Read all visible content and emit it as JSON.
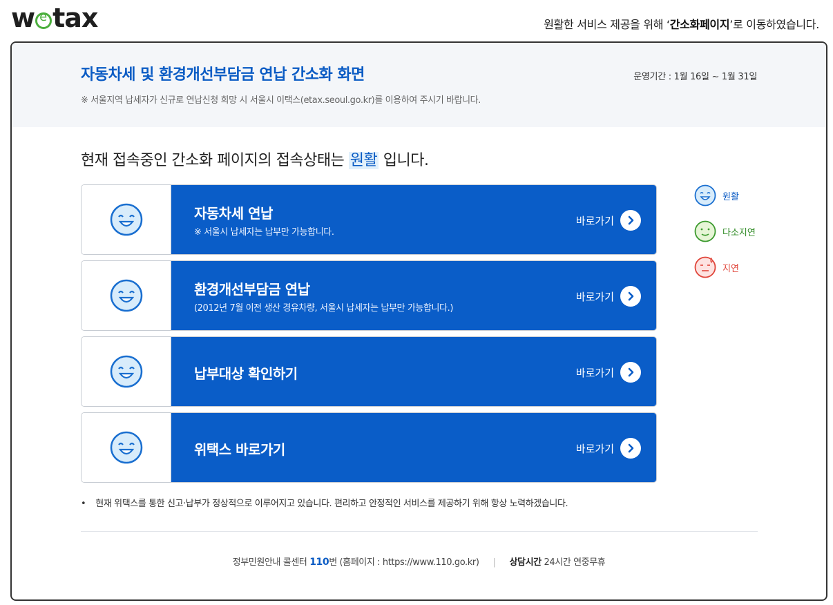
{
  "brand": {
    "name": "wetax",
    "prefix": "w",
    "suffix": "tax"
  },
  "top_notice": {
    "before": "원활한 서비스 제공을 위해 ‘",
    "strong": "간소화페이지",
    "after": "’로 이동하였습니다."
  },
  "header": {
    "title": "자동차세 및 환경개선부담금 연납 간소화 화면",
    "period": "운영기간 : 1월 16일 ~ 1월 31일",
    "notice": "※ 서울지역 납세자가 신규로 연납신청 희망 시 서울시 이택스(etax.seoul.go.kr)를 이용하여 주시기 바랍니다."
  },
  "status": {
    "before": "현재 접속중인 간소화 페이지의 접속상태는 ",
    "value": "원활",
    "after": " 입니다."
  },
  "menu": [
    {
      "label": "자동차세 연납",
      "desc": "※ 서울시 납세자는 납부만 가능합니다.",
      "go": "바로가기"
    },
    {
      "label": "환경개선부담금 연납",
      "desc": "(2012년 7월 이전 생산 경유차량, 서울시 납세자는 납부만 가능합니다.)",
      "go": "바로가기"
    },
    {
      "label": "납부대상 확인하기",
      "desc": "",
      "go": "바로가기"
    },
    {
      "label": "위택스 바로가기",
      "desc": "",
      "go": "바로가기"
    }
  ],
  "legend": [
    {
      "label": "원활",
      "color": "#0a5bc4",
      "icon": "smile-face-icon"
    },
    {
      "label": "다소지연",
      "color": "#2e8a23",
      "icon": "neutral-face-icon"
    },
    {
      "label": "지연",
      "color": "#e0453a",
      "icon": "sad-face-icon"
    }
  ],
  "bullet_note": "현재 위택스를 통한 신고·납부가 정상적으로 이루어지고 있습니다. 편리하고 안정적인 서비스를 제공하기 위해 항상 노력하겠습니다.",
  "footer": {
    "callcenter_before": "정부민원안내 콜센터 ",
    "callcenter_num": "110",
    "callcenter_after": "번 (홈페이지 : https://www.110.go.kr)",
    "hours_label": "상담시간",
    "hours_value": " 24시간 연중무휴"
  }
}
